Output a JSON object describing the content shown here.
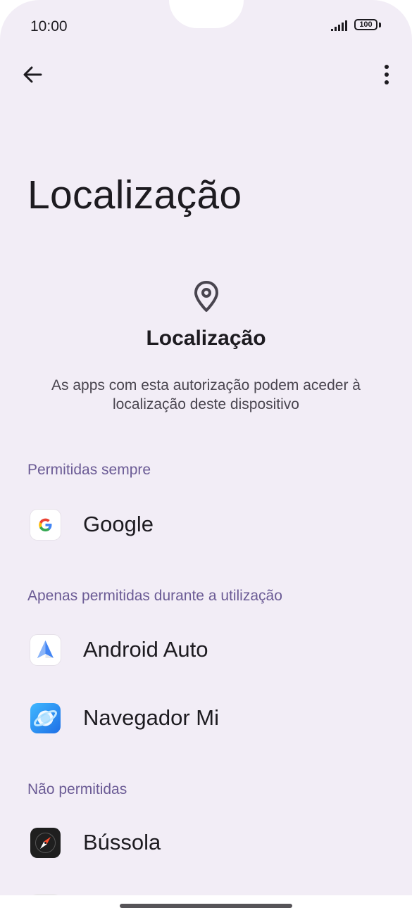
{
  "status_bar": {
    "time": "10:00",
    "battery": "100"
  },
  "page": {
    "title": "Localização"
  },
  "header": {
    "title": "Localização",
    "description": "As apps com esta autorização podem aceder à localização deste dispositivo"
  },
  "sections": [
    {
      "label": "Permitidas sempre",
      "apps": [
        {
          "name": "Google",
          "icon": "google-icon"
        }
      ]
    },
    {
      "label": "Apenas permitidas durante a utilização",
      "apps": [
        {
          "name": "Android Auto",
          "icon": "android-auto-icon"
        },
        {
          "name": "Navegador Mi",
          "icon": "mi-browser-icon"
        }
      ]
    },
    {
      "label": "Não permitidas",
      "apps": [
        {
          "name": "Bússola",
          "icon": "compass-icon"
        }
      ]
    }
  ],
  "colors": {
    "background": "#f2edf6",
    "section_label": "#6b5b95",
    "text": "#1d1b20"
  }
}
